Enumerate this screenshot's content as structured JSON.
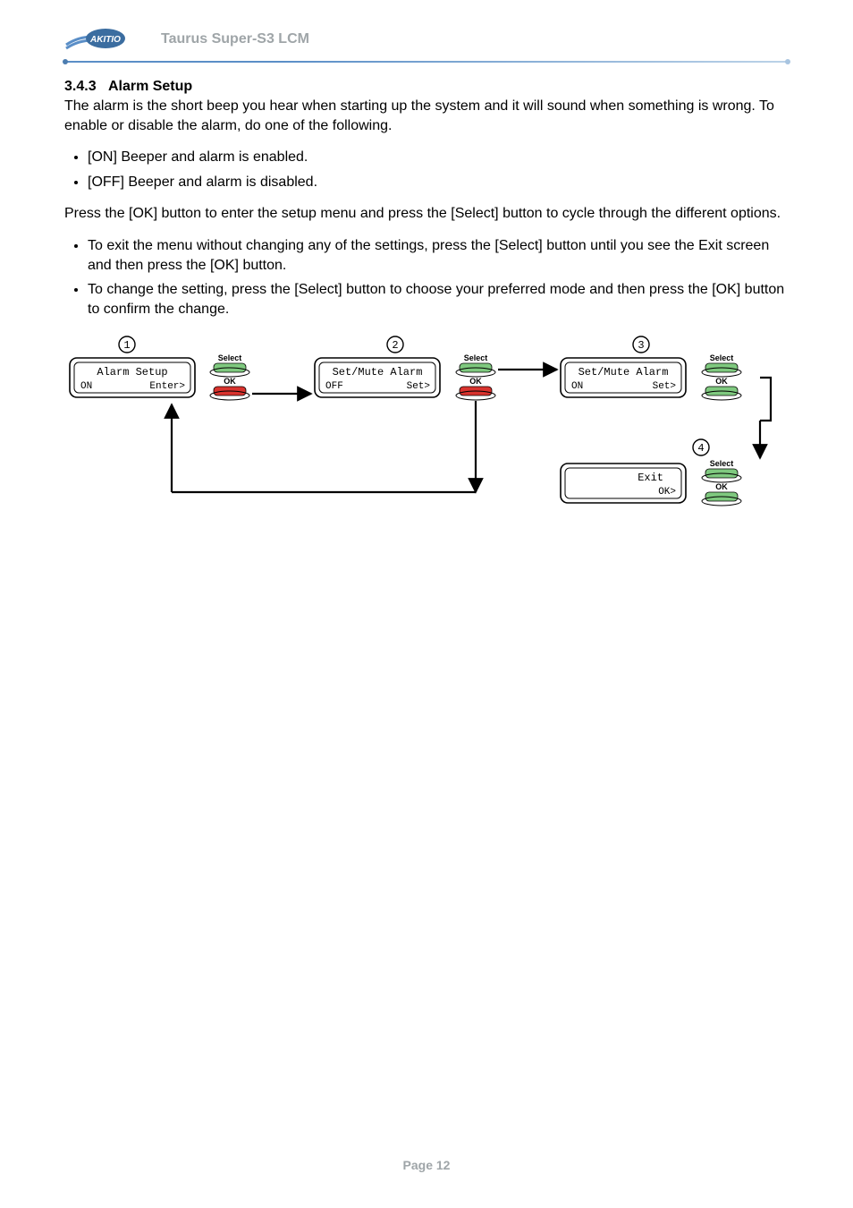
{
  "header": {
    "brand": "AKITIO",
    "title": "Taurus Super-S3 LCM"
  },
  "section": {
    "number": "3.4.3",
    "title": "Alarm Setup"
  },
  "intro": "The alarm is the short beep you hear when starting up the system and it will sound when something is wrong. To enable or disable the alarm, do one of the following.",
  "options": [
    "[ON] Beeper and alarm is enabled.",
    "[OFF] Beeper and alarm is disabled."
  ],
  "instruction": "Press the [OK] button to enter the setup menu and press the [Select] button to cycle through the different options.",
  "steps": [
    "To exit the menu without changing any of the settings, press the [Select] button until you see the Exit screen and then press the [OK] button.",
    "To change the setting, press the [Select] button to choose your preferred mode and then press the [OK] button to confirm the change."
  ],
  "diagram": {
    "step_labels": {
      "1": "1",
      "2": "2",
      "3": "3",
      "4": "4"
    },
    "screens": {
      "s1": {
        "line1": "Alarm Setup",
        "left": "ON",
        "right": "Enter>"
      },
      "s2": {
        "line1": "Set/Mute Alarm",
        "left": "OFF",
        "right": "Set>"
      },
      "s3": {
        "line1": "Set/Mute Alarm",
        "left": "ON",
        "right": "Set>"
      },
      "s4": {
        "line1": "Exit",
        "right": "OK>"
      }
    },
    "button_labels": {
      "select": "Select",
      "ok": "OK"
    }
  },
  "footer": "Page 12"
}
